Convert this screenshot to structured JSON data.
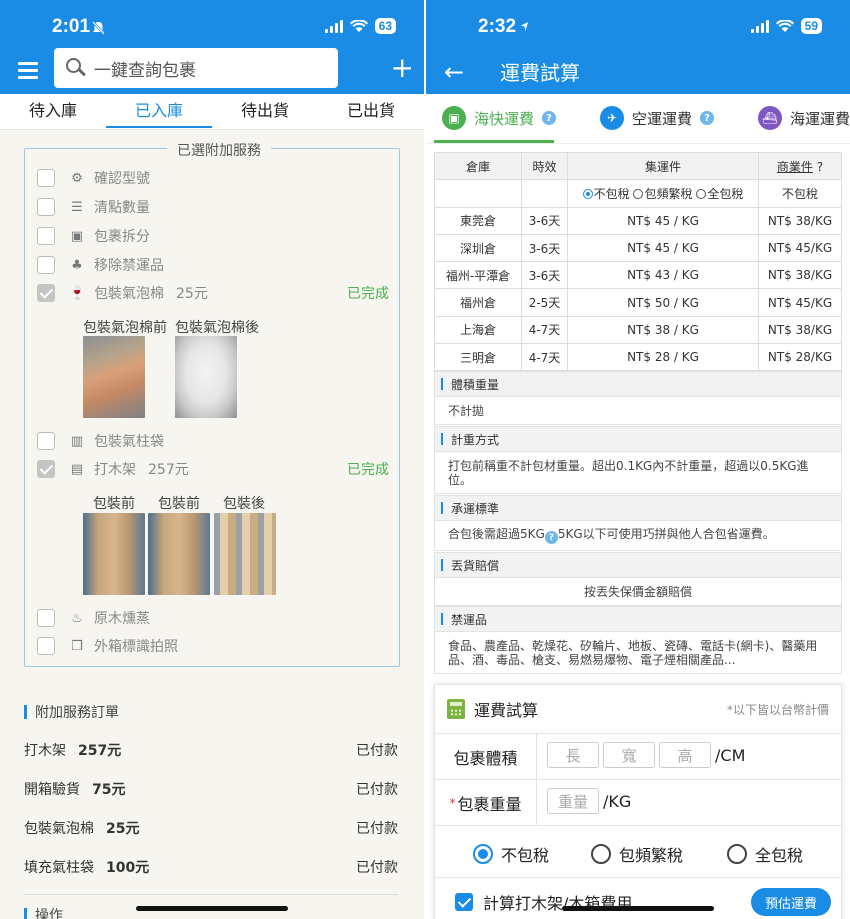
{
  "left": {
    "status": {
      "time": "2:01",
      "battery": "63"
    },
    "search": {
      "placeholder": "一鍵查詢包裹"
    },
    "tabs": [
      "待入庫",
      "已入庫",
      "待出貨",
      "已出貨"
    ],
    "services_legend": "已選附加服務",
    "services": [
      {
        "label": "確認型號",
        "price": "",
        "done": ""
      },
      {
        "label": "清點數量",
        "price": "",
        "done": ""
      },
      {
        "label": "包裹拆分",
        "price": "",
        "done": ""
      },
      {
        "label": "移除禁運品",
        "price": "",
        "done": ""
      },
      {
        "label": "包裝氣泡棉",
        "price": "25元",
        "done": "已完成"
      },
      {
        "label": "包裝氣柱袋",
        "price": "",
        "done": ""
      },
      {
        "label": "打木架",
        "price": "257元",
        "done": "已完成"
      },
      {
        "label": "原木燻蒸",
        "price": "",
        "done": ""
      },
      {
        "label": "外箱標識拍照",
        "price": "",
        "done": ""
      }
    ],
    "bubble_photos": [
      "包裝氣泡棉前",
      "包裝氣泡棉後"
    ],
    "crate_photos": [
      "包裝前",
      "包裝前",
      "包裝後"
    ],
    "order_section": "附加服務訂單",
    "orders": [
      {
        "name": "打木架",
        "price": "257元",
        "status": "已付款"
      },
      {
        "name": "開箱驗貨",
        "price": "75元",
        "status": "已付款"
      },
      {
        "name": "包裝氣泡棉",
        "price": "25元",
        "status": "已付款"
      },
      {
        "name": "填充氣柱袋",
        "price": "100元",
        "status": "已付款"
      }
    ],
    "ops_section": "操作"
  },
  "right": {
    "status": {
      "time": "2:32",
      "battery": "59"
    },
    "title": "運費試算",
    "tabs": [
      "海快運費",
      "空運運費",
      "海運運費"
    ],
    "table": {
      "headers": [
        "倉庫",
        "時效",
        "集運件",
        "商業件"
      ],
      "commercial_suffix": "?",
      "radio_options": [
        "不包稅",
        "包頻繁稅",
        "全包稅"
      ],
      "commercial_sub": "不包稅",
      "rows": [
        [
          "東莞倉",
          "3-6天",
          "NT$ 45 / KG",
          "NT$ 38/KG"
        ],
        [
          "深圳倉",
          "3-6天",
          "NT$ 45 / KG",
          "NT$ 45/KG"
        ],
        [
          "福州-平潭倉",
          "3-6天",
          "NT$ 43 / KG",
          "NT$ 38/KG"
        ],
        [
          "福州倉",
          "2-5天",
          "NT$ 50 / KG",
          "NT$ 45/KG"
        ],
        [
          "上海倉",
          "4-7天",
          "NT$ 38 / KG",
          "NT$ 38/KG"
        ],
        [
          "三明倉",
          "4-7天",
          "NT$ 28 / KG",
          "NT$ 28/KG"
        ]
      ]
    },
    "info": [
      {
        "title": "體積重量",
        "body": "不計拋"
      },
      {
        "title": "計重方式",
        "body": "打包前稱重不計包材重量。超出0.1KG內不計重量，超過以0.5KG進位。"
      },
      {
        "title": "承運標準",
        "body_a": "合包後需超過5KG",
        "body_b": "5KG以下可使用巧拼與他人合包省運費。"
      },
      {
        "title": "丟貨賠償",
        "body": "按丟失保價金額賠償"
      },
      {
        "title": "禁運品",
        "body": "食品、農產品、乾燥花、矽輪片、地板、瓷磚、電話卡(網卡)、醫藥用品、酒、毒品、槍支、易燃易爆物、電子煙相關產品..."
      }
    ],
    "calc": {
      "title": "運費試算",
      "note": "*以下皆以台幣計價",
      "volume_label": "包裹體積",
      "dims": [
        "長",
        "寬",
        "高"
      ],
      "volume_unit": "/CM",
      "weight_req": "*",
      "weight_label": "包裹重量",
      "weight_placeholder": "重量",
      "weight_unit": "/KG",
      "tax_options": [
        "不包稅",
        "包頻繁稅",
        "全包稅"
      ],
      "crate_label": "計算打木架/木箱費用",
      "estimate_button": "預估運費"
    }
  },
  "colors": {
    "primary": "#1a8ce6",
    "success": "#4caf50"
  }
}
